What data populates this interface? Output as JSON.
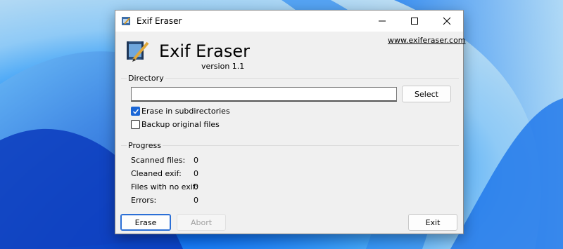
{
  "window": {
    "title": "Exif Eraser",
    "controls": {
      "minimize": "minimize-icon",
      "maximize": "maximize-icon",
      "close": "close-icon"
    }
  },
  "header": {
    "app_name": "Exif Eraser",
    "version": "version 1.1",
    "website": "www.exiferaser.com"
  },
  "directory": {
    "group_label": "Directory",
    "path_value": "",
    "select_label": "Select",
    "options": [
      {
        "label": "Erase in subdirectories",
        "checked": true
      },
      {
        "label": "Backup original files",
        "checked": false
      }
    ]
  },
  "progress": {
    "group_label": "Progress",
    "stats": [
      {
        "label": "Scanned files:",
        "value": "0"
      },
      {
        "label": "Cleaned exif:",
        "value": "0"
      },
      {
        "label": "Files with no exif:",
        "value": "0"
      },
      {
        "label": "Errors:",
        "value": "0"
      }
    ]
  },
  "actions": {
    "erase_label": "Erase",
    "abort_label": "Abort",
    "exit_label": "Exit"
  },
  "colors": {
    "accent": "#1a66d6",
    "window_bg": "#f0f0f0",
    "desktop": "#0b6cf0"
  }
}
